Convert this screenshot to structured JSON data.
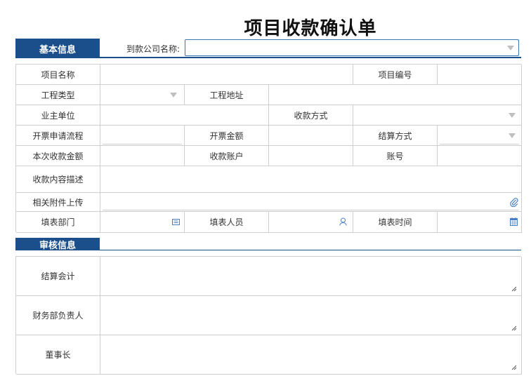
{
  "page_title": "项目收款确认单",
  "basic_section": {
    "tab_label": "基本信息",
    "company_label": "到款公司名称:",
    "company_value": ""
  },
  "fields": {
    "project_name": "项目名称",
    "project_no": "项目编号",
    "project_type": "工程类型",
    "project_address": "工程地址",
    "owner_unit": "业主单位",
    "payment_method": "收款方式",
    "invoice_flow": "开票申请流程",
    "invoice_amount": "开票金额",
    "settle_method": "结算方式",
    "this_amount": "本次收款金额",
    "receive_account": "收款账户",
    "account_no": "账号",
    "content_desc": "收款内容描述",
    "attachment": "相关附件上传",
    "dept": "填表部门",
    "filler": "填表人员",
    "fill_time": "填表时间"
  },
  "review_section": {
    "tab_label": "审核信息",
    "rows": [
      "结算会计",
      "财务部负责人",
      "董事长"
    ]
  },
  "icons": {
    "dropdown": "chevron-down-icon",
    "attach": "paperclip-icon",
    "dept": "org-card-icon",
    "user": "user-icon",
    "calendar": "calendar-icon"
  },
  "colors": {
    "accent": "#1a4f8b",
    "border": "#cfcfcf",
    "icon": "#4a7fc1"
  }
}
